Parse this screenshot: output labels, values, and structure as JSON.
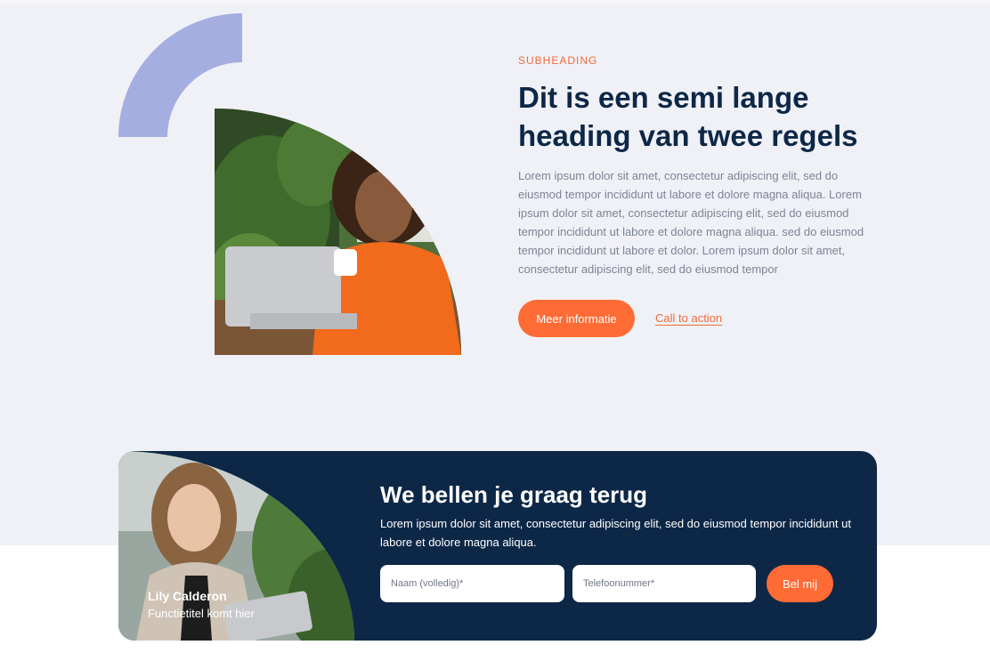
{
  "hero": {
    "subheading": "SUBHEADING",
    "heading": "Dit is een semi lange heading van twee regels",
    "body": "Lorem ipsum dolor sit amet, consectetur adipiscing elit, sed do eiusmod tempor incididunt ut labore et dolore magna aliqua. Lorem ipsum dolor sit amet, consectetur adipiscing elit, sed do eiusmod tempor incididunt ut labore et dolore magna aliqua. sed do eiusmod tempor incididunt ut labore et dolor. Lorem ipsum dolor sit amet, consectetur adipiscing elit, sed do eiusmod tempor",
    "primary_button": "Meer informatie",
    "cta_link": "Call to action",
    "image_icon": "woman-laptop-photo",
    "decor_icon": "quarter-arc-shape"
  },
  "callback": {
    "title": "We bellen je graag terug",
    "text": "Lorem ipsum dolor sit amet, consectetur adipiscing elit, sed do eiusmod tempor incididunt ut labore et dolore magna aliqua.",
    "name_placeholder": "Naam (volledig)*",
    "phone_placeholder": "Telefoonummer*",
    "submit": "Bel mij",
    "person_name": "Lily Calderon",
    "person_role": "Functietitel komt hier",
    "image_icon": "woman-tablet-photo"
  },
  "colors": {
    "accent": "#ff6b35",
    "navy": "#0d2747",
    "hero_bg": "#f0f1f7",
    "arc": "#a4aee0"
  }
}
